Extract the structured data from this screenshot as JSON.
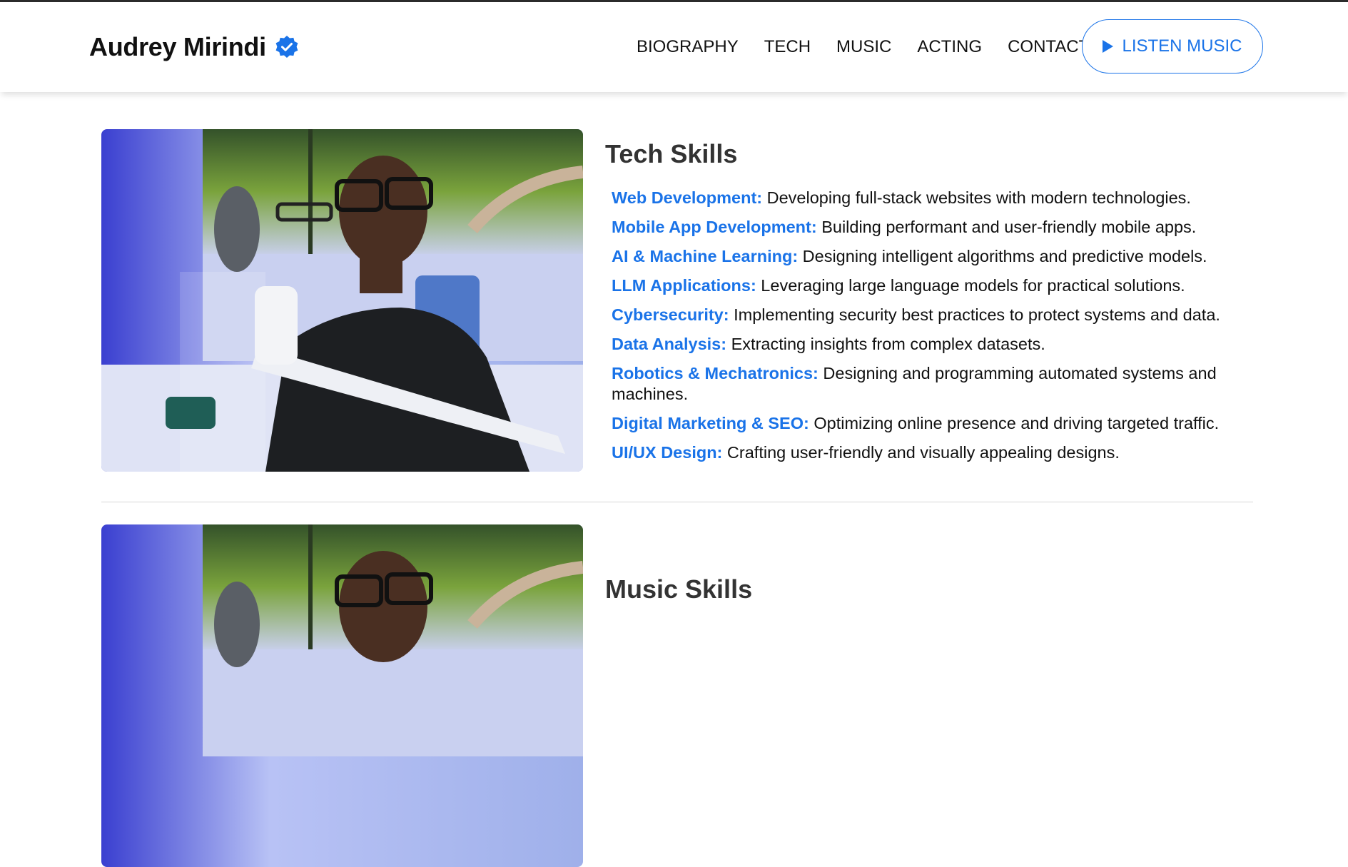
{
  "header": {
    "brand_name": "Audrey Mirindi",
    "nav": [
      "BIOGRAPHY",
      "TECH",
      "MUSIC",
      "ACTING",
      "CONTACT"
    ],
    "cta_label": "LISTEN MUSIC"
  },
  "tech": {
    "title": "Tech Skills",
    "skills": [
      {
        "name": "Web Development:",
        "desc": " Developing full-stack websites with modern technologies."
      },
      {
        "name": "Mobile App Development:",
        "desc": " Building performant and user-friendly mobile apps."
      },
      {
        "name": "AI & Machine Learning:",
        "desc": " Designing intelligent algorithms and predictive models."
      },
      {
        "name": "LLM Applications:",
        "desc": " Leveraging large language models for practical solutions."
      },
      {
        "name": "Cybersecurity:",
        "desc": " Implementing security best practices to protect systems and data."
      },
      {
        "name": "Data Analysis:",
        "desc": " Extracting insights from complex datasets."
      },
      {
        "name": "Robotics & Mechatronics:",
        "desc": " Designing and programming automated systems and machines."
      },
      {
        "name": "Digital Marketing & SEO:",
        "desc": " Optimizing online presence and driving targeted traffic."
      },
      {
        "name": "UI/UX Design:",
        "desc": " Crafting user-friendly and visually appealing designs."
      }
    ]
  },
  "music": {
    "title": "Music Skills"
  },
  "colors": {
    "accent": "#1a73e8",
    "text": "#111111",
    "heading": "#333333"
  },
  "icons": {
    "verified": "verified-badge-icon",
    "play": "play-icon"
  }
}
